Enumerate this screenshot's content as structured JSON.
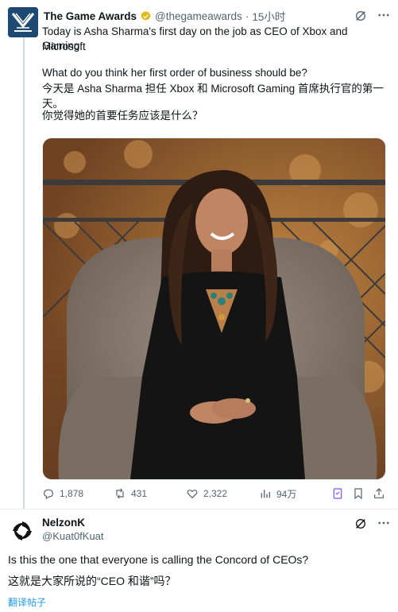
{
  "tweet": {
    "author_name": "The Game Awards",
    "author_handle": "@thegameawards",
    "separator": "·",
    "time": "15小时",
    "text_en_line1": "Today is Asha Sharma's first day on the job as CEO of Xbox and Microsoft",
    "text_en_line2": "Gaming.",
    "question_en": "What do you think her first order of business should be?",
    "text_zh": "今天是 Asha Sharma 担任 Xbox 和 Microsoft Gaming 首席执行官的第一天。",
    "question_zh": "你觉得她的首要任务应该是什么？",
    "stats": {
      "replies": "1,878",
      "retweets": "431",
      "likes": "2,322",
      "views": "94万"
    }
  },
  "reply": {
    "author_name": "NelzonK",
    "author_handle": "@Kuat0fKuat",
    "text_en": "Is this the one that everyone is calling the Concord of CEOs?",
    "text_zh": "这就是大家所说的“CEO 和谐”吗？",
    "translate_label": "翻译帖子"
  },
  "colors": {
    "accent": "#1d9bf0",
    "muted": "#536471",
    "verified_gold": "#e2b719",
    "bookmark_active": "#7856ff"
  }
}
